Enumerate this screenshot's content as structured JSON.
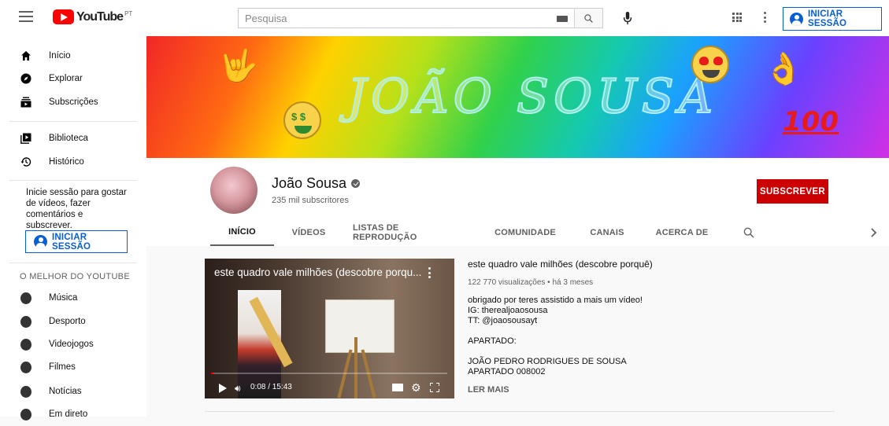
{
  "topbar": {
    "logo_text": "YouTube",
    "region": "PT",
    "search_placeholder": "Pesquisa",
    "sign_in": "INICIAR SESSÃO"
  },
  "sidebar": {
    "items": [
      {
        "label": "Início",
        "icon": "home-icon"
      },
      {
        "label": "Explorar",
        "icon": "compass-icon"
      },
      {
        "label": "Subscrições",
        "icon": "subscriptions-icon"
      },
      {
        "label": "Biblioteca",
        "icon": "library-icon"
      },
      {
        "label": "Histórico",
        "icon": "history-icon"
      }
    ],
    "signin_note": "Inicie sessão para gostar de vídeos, fazer comentários e subscrever.",
    "sign_in": "INICIAR SESSÃO",
    "best_heading": "O MELHOR DO YOUTUBE",
    "best_items": [
      {
        "label": "Música",
        "icon": "music-icon"
      },
      {
        "label": "Desporto",
        "icon": "trophy-icon"
      },
      {
        "label": "Videojogos",
        "icon": "gamepad-icon"
      },
      {
        "label": "Filmes",
        "icon": "film-icon"
      },
      {
        "label": "Notícias",
        "icon": "news-icon"
      },
      {
        "label": "Em direto",
        "icon": "live-icon"
      }
    ]
  },
  "banner": {
    "text": "JOÃO SOUSA",
    "badge": "100"
  },
  "channel": {
    "name": "João Sousa",
    "subscribers": "235 mil subscritores",
    "subscribe_label": "SUBSCREVER",
    "tabs": [
      "INÍCIO",
      "VÍDEOS",
      "LISTAS DE REPRODUÇÃO",
      "COMUNIDADE",
      "CANAIS",
      "ACERCA DE"
    ],
    "active_tab": "INÍCIO"
  },
  "featured": {
    "player_title": "este quadro vale milhões (descobre porqu...",
    "time": "0:08 / 15:43",
    "progress": 0.009,
    "title": "este quadro vale milhões (descobre porquê)",
    "meta": "122 770 visualizações • há 3 meses",
    "description": [
      "obrigado por teres assistido a mais um vídeo!",
      "IG: therealjoaosousa",
      "TT: @joaosousayt",
      "",
      "APARTADO:",
      "",
      "JOÃO PEDRO RODRIGUES DE SOUSA",
      "APARTADO 008002"
    ],
    "read_more": "LER MAIS"
  },
  "colors": {
    "accent_blue": "#065fd4",
    "subscribe_red": "#cc0000"
  }
}
